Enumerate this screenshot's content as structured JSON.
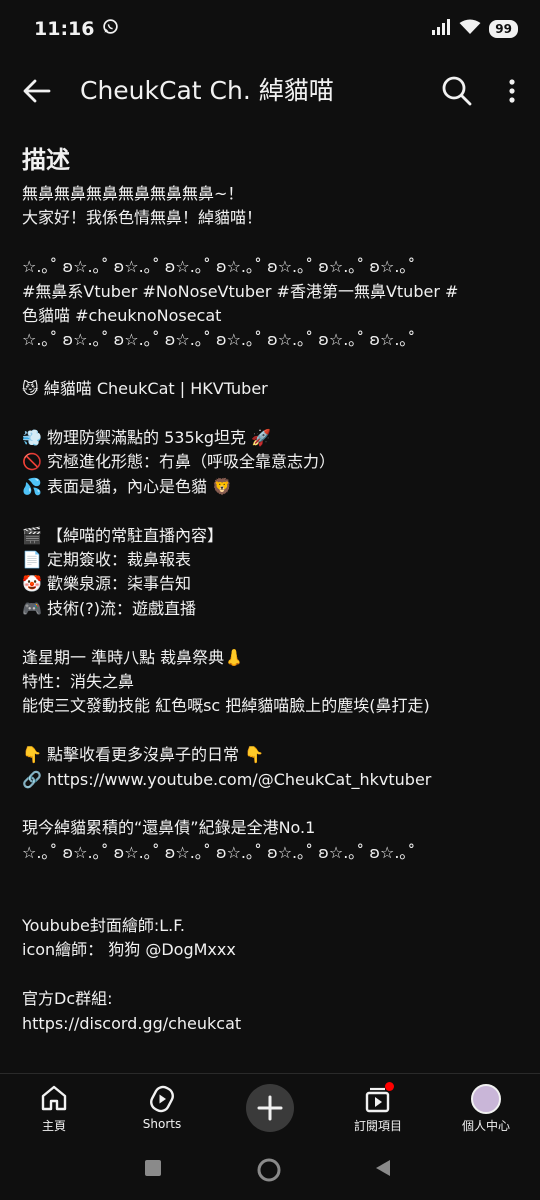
{
  "status_bar": {
    "time": "11:16",
    "battery": "99",
    "icons": [
      "whatsapp-icon",
      "signal-icon",
      "wifi-icon",
      "battery-icon"
    ]
  },
  "app_bar": {
    "title": "CheukCat Ch. 綽貓喵",
    "icons": [
      "back-arrow-icon",
      "search-icon",
      "more-vert-icon"
    ]
  },
  "description": {
    "heading": "描述",
    "lines": [
      "無鼻無鼻無鼻無鼻無鼻無鼻~！",
      "大家好！我係色情無鼻！綽貓喵！",
      "",
      "☆.｡˚ ʚ☆.｡˚ ʚ☆.｡˚ ʚ☆.｡˚ ʚ☆.｡˚ ʚ☆.｡˚ ʚ☆.｡˚ ʚ☆.｡˚",
      "#無鼻系Vtuber #NoNoseVtuber #香港第一無鼻Vtuber #",
      "色貓喵 #cheuknoNosecat",
      "☆.｡˚ ʚ☆.｡˚ ʚ☆.｡˚ ʚ☆.｡˚ ʚ☆.｡˚ ʚ☆.｡˚ ʚ☆.｡˚ ʚ☆.｡˚",
      "",
      "😼 綽貓喵 CheukCat | HKVTuber",
      "",
      "💨 物理防禦滿點的 535kg坦克 🚀",
      "🚫 究極進化形態：冇鼻（呼吸全靠意志力）",
      "💦 表面是貓，內心是色貓 🦁",
      "",
      "🎬 【綽喵的常駐直播內容】",
      "📄 定期簽收：裁鼻報表",
      "🤡 歡樂泉源：柒事告知",
      "🎮 技術(?)流：遊戲直播",
      "",
      "逢星期一 準時八點 裁鼻祭典👃",
      "特性：消失之鼻",
      "能使三文發動技能 紅色嘅sc 把綽貓喵臉上的塵埃(鼻打走)",
      "",
      "👇 點擊收看更多沒鼻子的日常 👇",
      "🔗 https://www.youtube.com/@CheukCat_hkvtuber",
      "",
      "現今綽貓累積的“還鼻債”紀錄是全港No.1",
      "☆.｡˚ ʚ☆.｡˚ ʚ☆.｡˚ ʚ☆.｡˚ ʚ☆.｡˚ ʚ☆.｡˚ ʚ☆.｡˚ ʚ☆.｡˚",
      "",
      "",
      "Youbube封面繪師:L.F.",
      "icon繪師： 狗狗 @DogMxxx",
      "",
      "官方Dc群組:",
      "https://discord.gg/cheukcat"
    ]
  },
  "bottom_nav": {
    "home": "主頁",
    "shorts": "Shorts",
    "subscriptions": "訂閱項目",
    "you": "個人中心"
  },
  "colors": {
    "background": "#0f0f0f",
    "text": "#f1f1f1",
    "notification": "#ff0000"
  }
}
